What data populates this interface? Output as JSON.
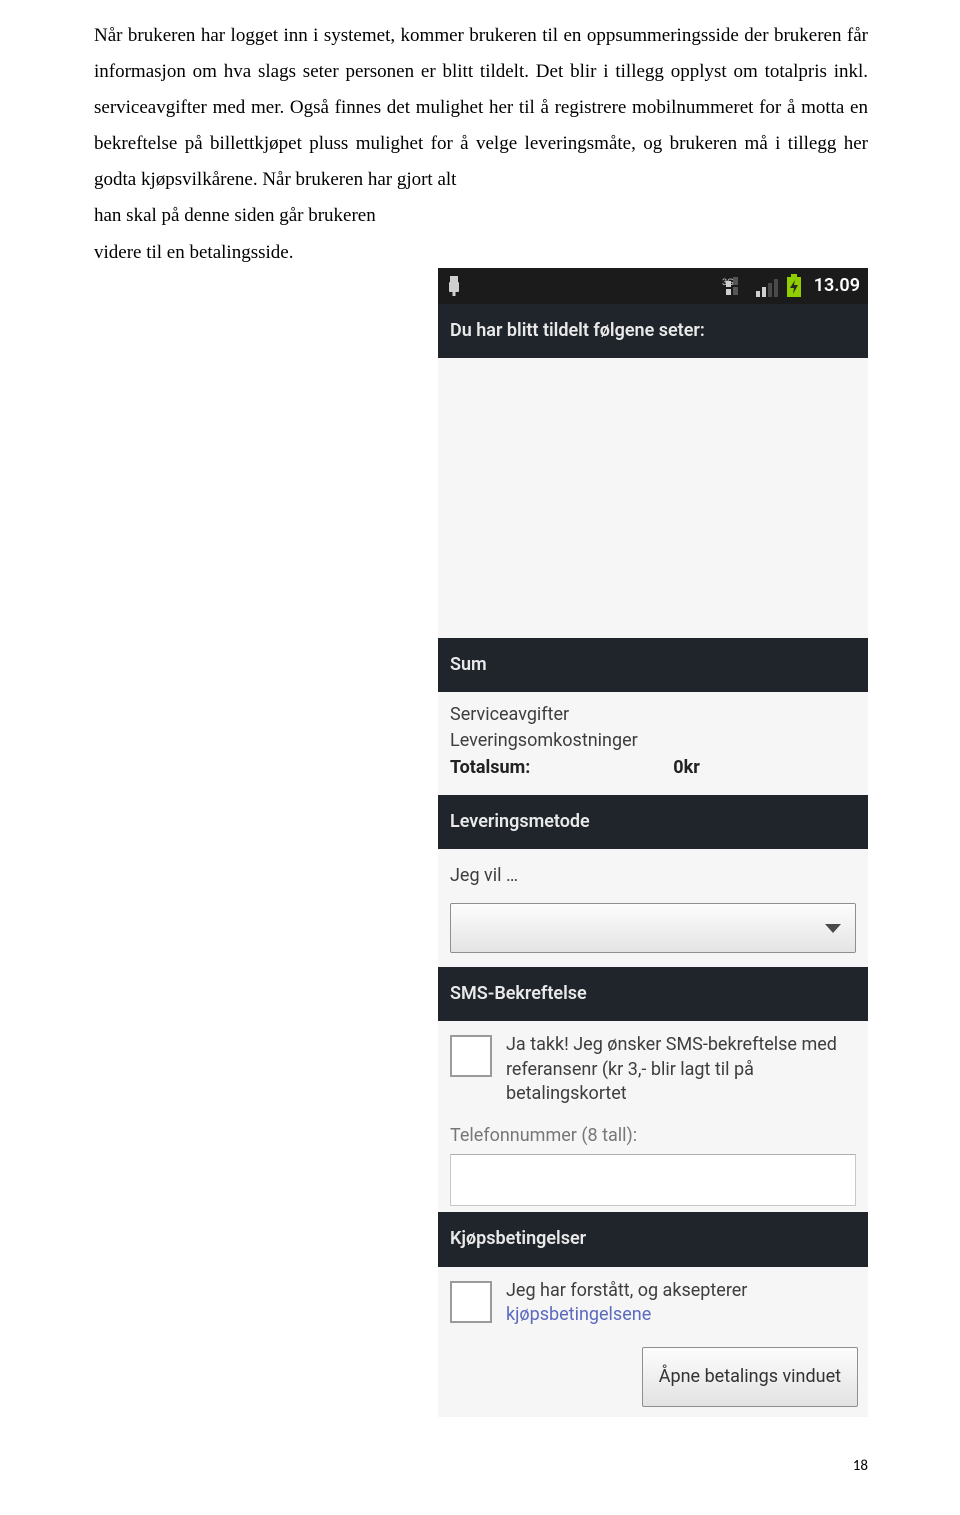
{
  "doc": {
    "paragraph": "Når brukeren har logget inn i systemet, kommer brukeren til en oppsummeringsside der brukeren får informasjon om hva slags seter personen er blitt tildelt. Det blir i tillegg opplyst om totalpris inkl. serviceavgifter med mer. Også finnes det mulighet her til å registrere mobilnummeret for å motta en bekreftelse på billettkjøpet pluss mulighet for å velge leveringsmåte, og brukeren må i tillegg her godta kjøpsvilkårene. Når brukeren har gjort alt",
    "line6": "han skal på denne siden går brukeren",
    "line7": "videre til en betalingsside.",
    "page_number": "18"
  },
  "phone": {
    "status": {
      "clock": "13.09",
      "network_label": "3G"
    },
    "seats_header": "Du har blitt tildelt følgene seter:",
    "sum": {
      "header": "Sum",
      "service": "Serviceavgifter",
      "delivery_costs": "Leveringsomkostninger",
      "total_label": "Totalsum:",
      "total_value": "0kr"
    },
    "delivery": {
      "header": "Leveringsmetode",
      "prompt": "Jeg vil …"
    },
    "sms": {
      "header": "SMS-Bekreftelse",
      "text": "Ja takk! Jeg ønsker SMS-bekreftelse med referansenr (kr 3,- blir lagt til på betalingskortet",
      "phone_label": "Telefonnummer (8 tall):"
    },
    "terms": {
      "header": "Kjøpsbetingelser",
      "text_pre": "Jeg har forstått, og aksepterer ",
      "link": "kjøpsbetingelsene"
    },
    "footer": {
      "open_payment": "Åpne betalings vinduet"
    }
  }
}
